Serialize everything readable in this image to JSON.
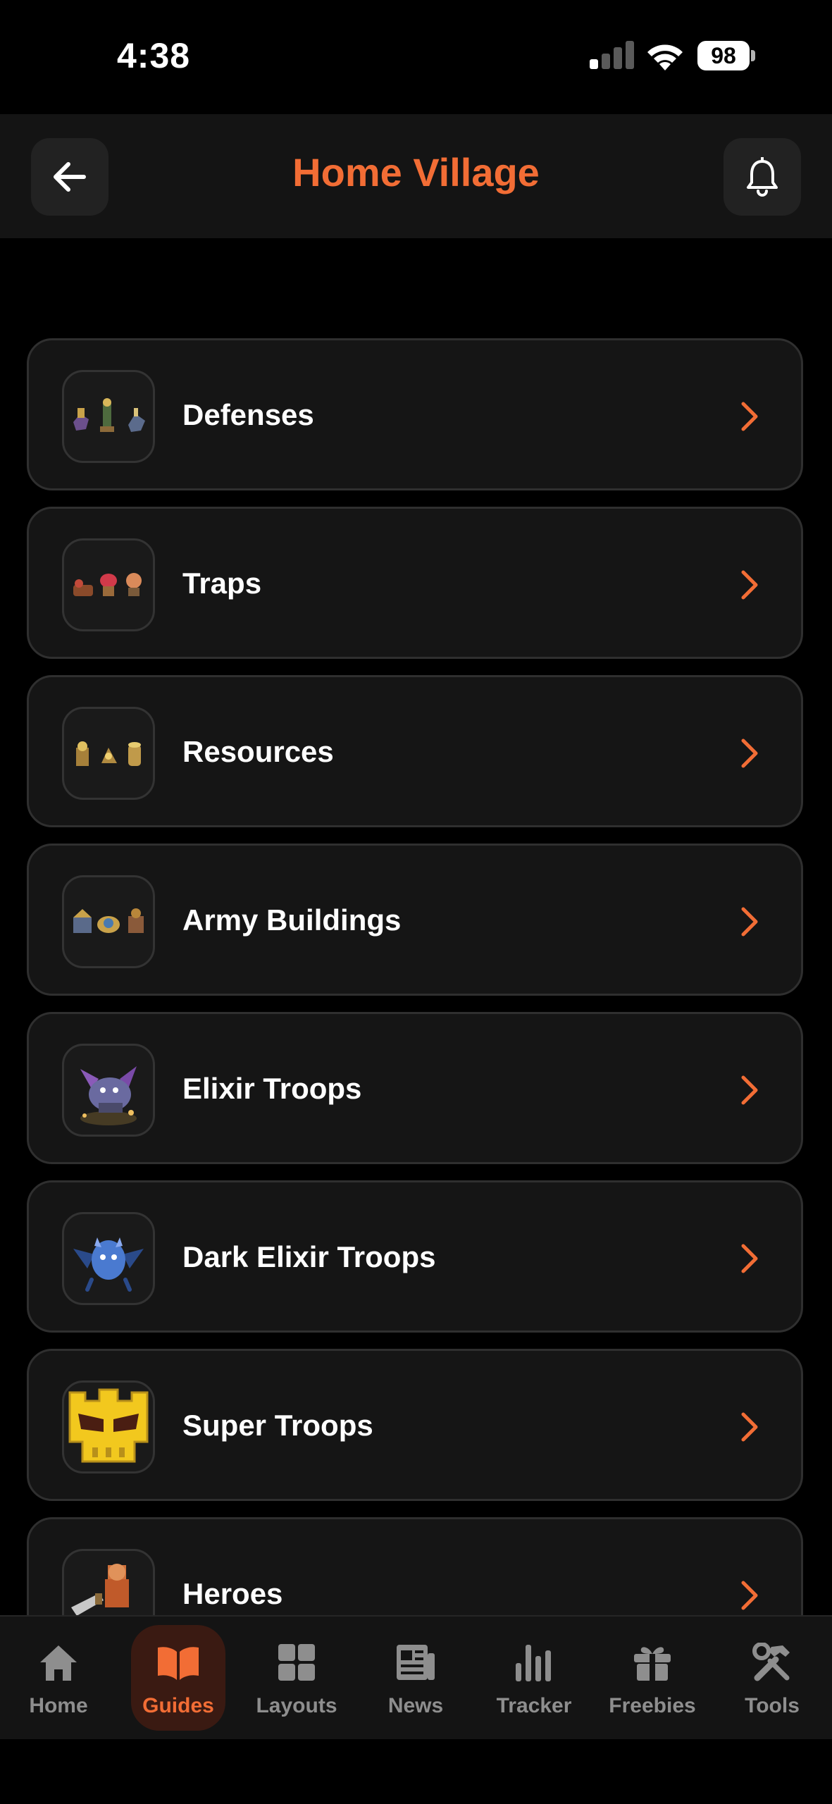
{
  "status_bar": {
    "time": "4:38",
    "battery": "98"
  },
  "header": {
    "title": "Home Village"
  },
  "list": [
    {
      "label": "Defenses",
      "icon": "defenses-buildings-icon"
    },
    {
      "label": "Traps",
      "icon": "traps-icon"
    },
    {
      "label": "Resources",
      "icon": "resource-buildings-icon"
    },
    {
      "label": "Army Buildings",
      "icon": "army-buildings-icon"
    },
    {
      "label": "Elixir Troops",
      "icon": "elixir-troop-icon"
    },
    {
      "label": "Dark Elixir Troops",
      "icon": "dark-elixir-troop-icon"
    },
    {
      "label": "Super Troops",
      "icon": "super-troop-skull-icon"
    },
    {
      "label": "Heroes",
      "icon": "hero-icon"
    }
  ],
  "bottom_nav": [
    {
      "label": "Home",
      "icon": "home-icon",
      "active": false
    },
    {
      "label": "Guides",
      "icon": "book-icon",
      "active": true
    },
    {
      "label": "Layouts",
      "icon": "grid-icon",
      "active": false
    },
    {
      "label": "News",
      "icon": "newspaper-icon",
      "active": false
    },
    {
      "label": "Tracker",
      "icon": "bar-chart-icon",
      "active": false
    },
    {
      "label": "Freebies",
      "icon": "gift-icon",
      "active": false
    },
    {
      "label": "Tools",
      "icon": "tools-icon",
      "active": false
    }
  ],
  "colors": {
    "accent": "#f26d35",
    "card_bg": "#151515",
    "card_border": "#2f2f2f",
    "nav_inactive": "#8e8e8e"
  }
}
